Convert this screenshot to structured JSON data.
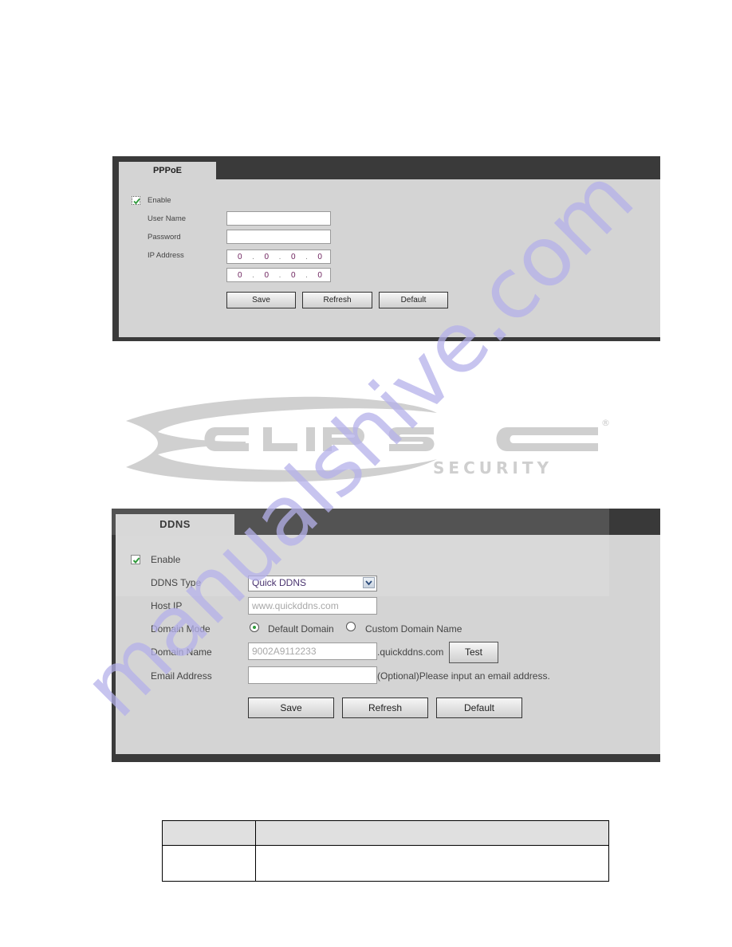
{
  "pppoe": {
    "tab_label": "PPPoE",
    "enable_label": "Enable",
    "enable_checked": true,
    "user_name_label": "User Name",
    "user_name_value": "",
    "password_label": "Password",
    "password_value": "",
    "ip_address_label": "IP Address",
    "ip_address": [
      "0",
      "0",
      "0",
      "0"
    ],
    "ip_address_2": [
      "0",
      "0",
      "0",
      "0"
    ],
    "buttons": {
      "save": "Save",
      "refresh": "Refresh",
      "default": "Default"
    }
  },
  "logo": {
    "brand": "ECLIPSE",
    "letters": "CLIPSE",
    "subtitle": "SECURITY",
    "registered_mark": "®"
  },
  "ddns": {
    "tab_label": "DDNS",
    "enable_label": "Enable",
    "enable_checked": true,
    "ddns_type_label": "DDNS Type",
    "ddns_type_value": "Quick DDNS",
    "host_ip_label": "Host IP",
    "host_ip_value": "www.quickddns.com",
    "domain_mode_label": "Domain Mode",
    "domain_mode_options": [
      "Default Domain",
      "Custom Domain Name"
    ],
    "domain_mode_selected": "Default Domain",
    "domain_name_label": "Domain Name",
    "domain_name_value": "9002A9112233",
    "domain_suffix": ".quickddns.com",
    "test_button": "Test",
    "email_label": "Email Address",
    "email_value": "",
    "email_hint": "(Optional)Please input an email address.",
    "buttons": {
      "save": "Save",
      "refresh": "Refresh",
      "default": "Default"
    }
  },
  "table": {
    "headers": [
      "",
      ""
    ],
    "rows": [
      [
        "",
        ""
      ]
    ]
  },
  "watermark": {
    "text": "manualshive.com",
    "color": "#b4b0ea"
  },
  "colors": {
    "panel_dark": "#3a3a3a",
    "panel_body": "#d4d4d4",
    "check_green": "#2e9a3a",
    "ip_digits": "#6b1f5b"
  }
}
